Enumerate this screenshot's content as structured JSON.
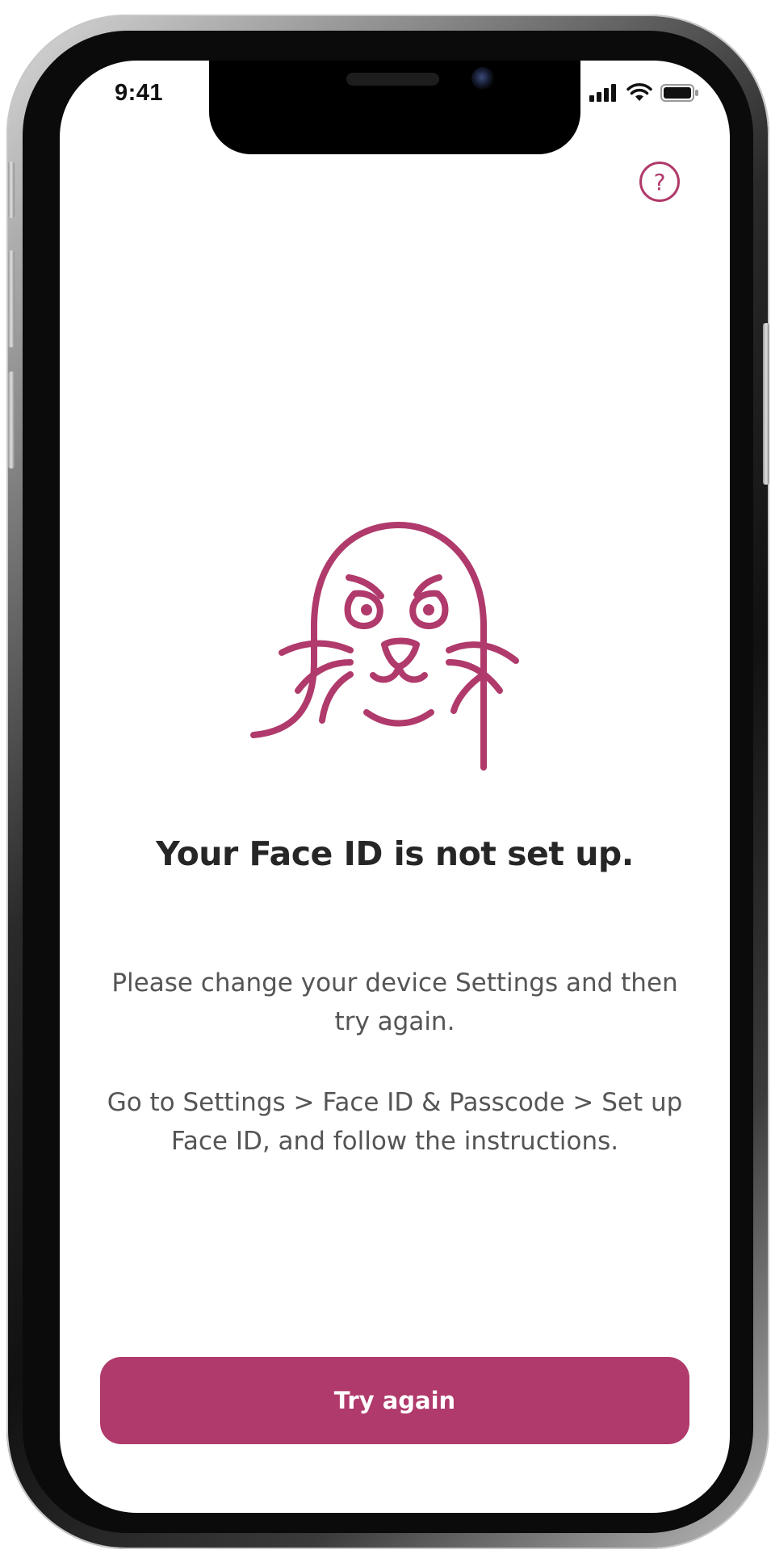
{
  "status_bar": {
    "time": "9:41",
    "signal_icon": "cellular-signal-icon",
    "wifi_icon": "wifi-icon",
    "battery_icon": "battery-icon"
  },
  "help": {
    "icon": "help-question-icon",
    "glyph": "?"
  },
  "illustration": {
    "icon": "sad-seal-illustration"
  },
  "content": {
    "title": "Your Face ID is not set up.",
    "message": "Please change your device Settings and then try again.",
    "instructions": "Go to Settings > Face ID & Passcode > Set up Face ID, and follow the instructions."
  },
  "actions": {
    "try_again_label": "Try again"
  },
  "colors": {
    "accent": "#b03a6b",
    "title_text": "#262626",
    "body_text": "#555555",
    "background": "#ffffff"
  }
}
